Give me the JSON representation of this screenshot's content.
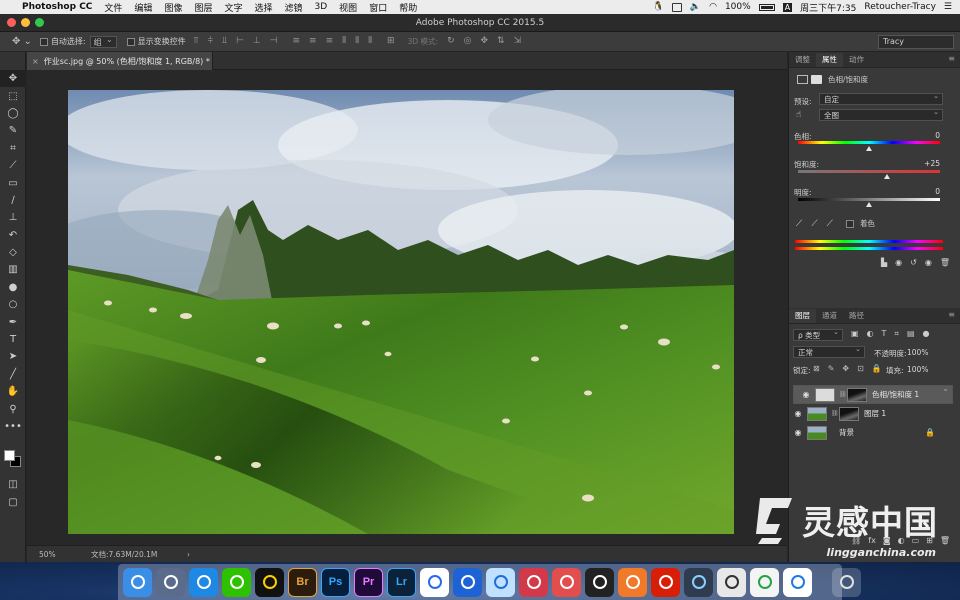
{
  "menubar": {
    "apple": "",
    "app_name": "Photoshop CC",
    "items": [
      "文件",
      "编辑",
      "图像",
      "图层",
      "文字",
      "选择",
      "滤镜",
      "3D",
      "视图",
      "窗口",
      "帮助"
    ],
    "battery": "100%",
    "input_method": "A",
    "datetime": "周三下午7:35",
    "user": "Retoucher-Tracy"
  },
  "window": {
    "title": "Adobe Photoshop CC 2015.5"
  },
  "options_bar": {
    "auto_select_label": "自动选择:",
    "auto_select_value": "组",
    "show_transform_label": "显示变换控件",
    "mode_3d_label": "3D 模式:",
    "workspace": "Tracy"
  },
  "document": {
    "tab_title": "作业sc.jpg @ 50% (色相/饱和度 1, RGB/8) *",
    "zoom": "50%",
    "doc_size": "文档:7.63M/20.1M"
  },
  "properties_panel": {
    "tabs": [
      "调整",
      "属性",
      "动作"
    ],
    "active_tab": "属性",
    "title": "色相/饱和度",
    "preset_label": "预设:",
    "preset_value": "自定",
    "channel_value": "全图",
    "hue": {
      "label": "色相:",
      "value": "0",
      "fraction": 0.5
    },
    "saturation": {
      "label": "饱和度:",
      "value": "+25",
      "fraction": 0.625
    },
    "lightness": {
      "label": "明度:",
      "value": "0",
      "fraction": 0.5
    },
    "colorize_label": "着色"
  },
  "layers_panel": {
    "tabs": [
      "图层",
      "通道",
      "路径"
    ],
    "active_tab": "图层",
    "filter_label": "ρ 类型",
    "blend_mode": "正常",
    "opacity_label": "不透明度:",
    "opacity_value": "100%",
    "lock_label": "锁定:",
    "fill_label": "填充:",
    "fill_value": "100%",
    "layers": [
      {
        "name": "色相/饱和度 1",
        "selected": true
      },
      {
        "name": "图层 1",
        "selected": false
      },
      {
        "name": "背景",
        "selected": false
      }
    ]
  },
  "watermark": {
    "text": "灵感中国",
    "url": "lingganchina.com"
  },
  "dock": {
    "apps": [
      {
        "icon": "finder-icon",
        "label": "",
        "bg": "#3a8ee6",
        "fg": "#ffffff"
      },
      {
        "icon": "launchpad-icon",
        "label": "",
        "bg": "#5b6b8c",
        "fg": "#ffffff"
      },
      {
        "icon": "safari-icon",
        "label": "",
        "bg": "#1e88e5",
        "fg": "#ffffff"
      },
      {
        "icon": "wechat-icon",
        "label": "",
        "bg": "#2dc100",
        "fg": "#ffffff"
      },
      {
        "icon": "qq-icon",
        "label": "",
        "bg": "#111111",
        "fg": "#ffcc00"
      },
      {
        "icon": "bridge-icon",
        "label": "Br",
        "bg": "#2b1c0e",
        "fg": "#e8a23a"
      },
      {
        "icon": "photoshop-icon",
        "label": "Ps",
        "bg": "#061e3c",
        "fg": "#31a8ff"
      },
      {
        "icon": "premiere-icon",
        "label": "Pr",
        "bg": "#1f0a3a",
        "fg": "#ea77ff"
      },
      {
        "icon": "lightroom-icon",
        "label": "Lr",
        "bg": "#0b2238",
        "fg": "#31a8ff"
      },
      {
        "icon": "baidu-netdisk-icon",
        "label": "",
        "bg": "#ffffff",
        "fg": "#2a6ae8"
      },
      {
        "icon": "screen-recorder-icon",
        "label": "",
        "bg": "#1e63d6",
        "fg": "#ffffff"
      },
      {
        "icon": "one-password-icon",
        "label": "",
        "bg": "#bfe0ff",
        "fg": "#1f6fd6"
      },
      {
        "icon": "davinci-icon",
        "label": "",
        "bg": "#d23a4a",
        "fg": "#ffffff"
      },
      {
        "icon": "player-icon",
        "label": "",
        "bg": "#e24d4d",
        "fg": "#ffffff"
      },
      {
        "icon": "obs-icon",
        "label": "",
        "bg": "#222222",
        "fg": "#ffffff"
      },
      {
        "icon": "xiami-icon",
        "label": "",
        "bg": "#f07a2a",
        "fg": "#ffffff"
      },
      {
        "icon": "netease-music-icon",
        "label": "",
        "bg": "#d81e06",
        "fg": "#ffffff"
      },
      {
        "icon": "quicktime-icon",
        "label": "",
        "bg": "#2f3b4e",
        "fg": "#8ad0ff"
      },
      {
        "icon": "preview-icon",
        "label": "",
        "bg": "#e8e8e8",
        "fg": "#333333"
      },
      {
        "icon": "numbers-icon",
        "label": "",
        "bg": "#f4f4f4",
        "fg": "#24a24a"
      },
      {
        "icon": "keynote-icon",
        "label": "",
        "bg": "#ffffff",
        "fg": "#1f7ae0"
      },
      {
        "icon": "trash-icon",
        "label": "",
        "bg": "rgba(255,255,255,0.2)",
        "fg": "#e0e0e0"
      }
    ]
  }
}
